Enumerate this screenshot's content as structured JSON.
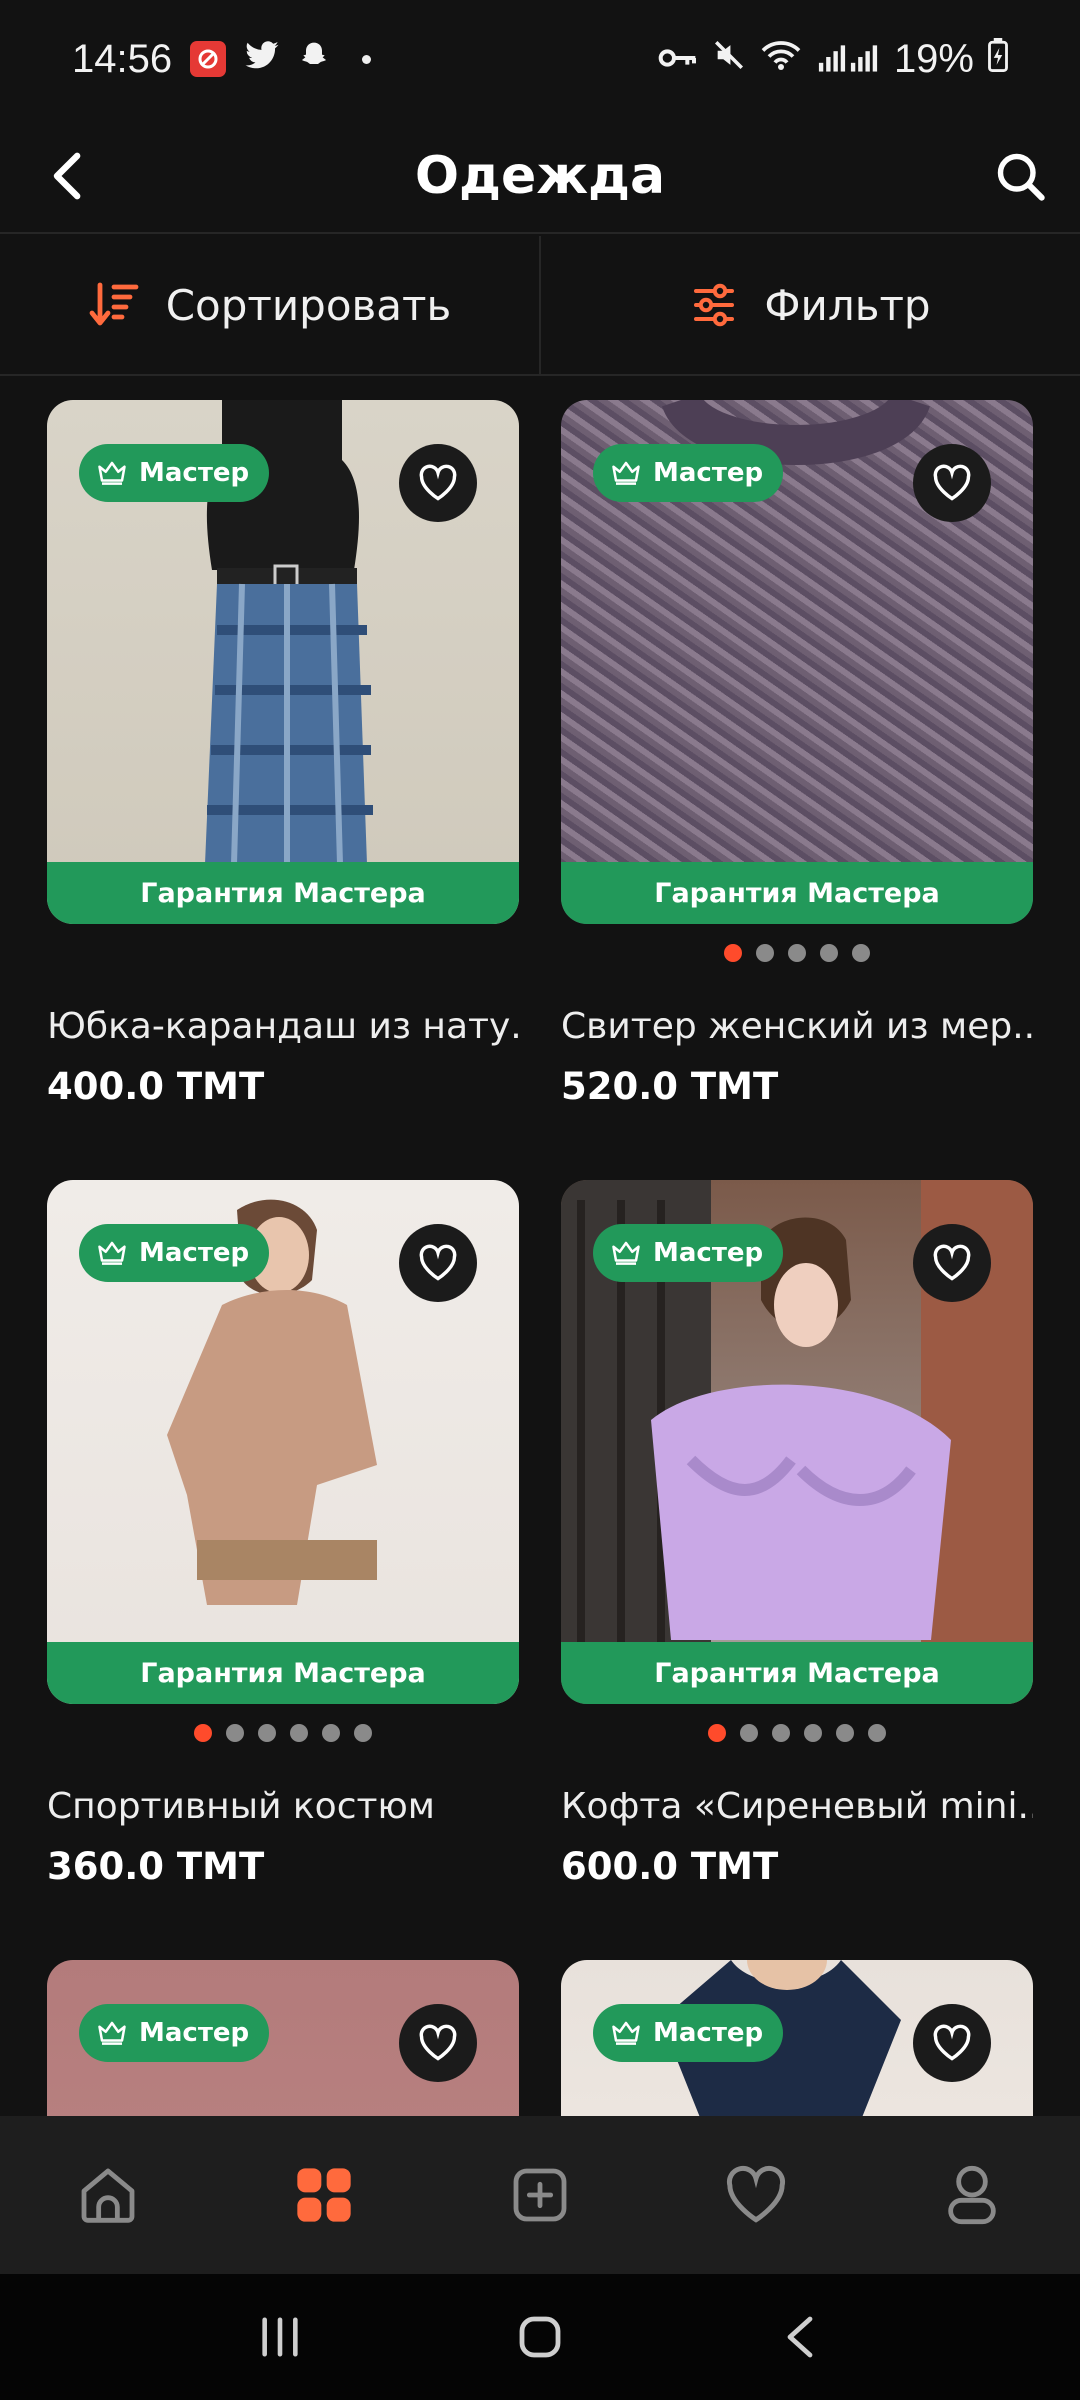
{
  "status_bar": {
    "time": "14:56",
    "battery": "19%",
    "icons": [
      "notification-app-icon",
      "twitter-icon",
      "snapchat-icon",
      "key-icon",
      "mute-icon",
      "wifi-icon",
      "signal-icon",
      "battery-charging-icon"
    ]
  },
  "header": {
    "title": "Одежда",
    "back_icon": "chevron-left-icon",
    "search_icon": "search-icon"
  },
  "toolbar": {
    "sort_label": "Сортировать",
    "filter_label": "Фильтр"
  },
  "colors": {
    "background": "#121212",
    "accent": "#ff6a3d",
    "badge_green": "#22995a",
    "active_dot": "#ff4b2b"
  },
  "products": [
    {
      "badge": "Мастер",
      "guarantee": "Гарантия Мастера",
      "title": "Юбка-карандаш из нату...",
      "price": "400.0 TMT",
      "dots": 0,
      "active_dot": 0
    },
    {
      "badge": "Мастер",
      "guarantee": "Гарантия Мастера",
      "title": "Свитер женский из мер...",
      "price": "520.0 TMT",
      "dots": 5,
      "active_dot": 0
    },
    {
      "badge": "Мастер",
      "guarantee": "Гарантия Мастера",
      "title": "Спортивный костюм",
      "price": "360.0 TMT",
      "dots": 6,
      "active_dot": 0
    },
    {
      "badge": "Мастер",
      "guarantee": "Гарантия Мастера",
      "title": "Кофта «Сиреневый mini...",
      "price": "600.0 TMT",
      "dots": 6,
      "active_dot": 0
    },
    {
      "badge": "Мастер"
    },
    {
      "badge": "Мастер"
    }
  ],
  "bottom_nav": {
    "items": [
      "home-icon",
      "catalog-icon",
      "add-icon",
      "favorites-icon",
      "profile-icon"
    ],
    "active": "catalog-icon"
  }
}
